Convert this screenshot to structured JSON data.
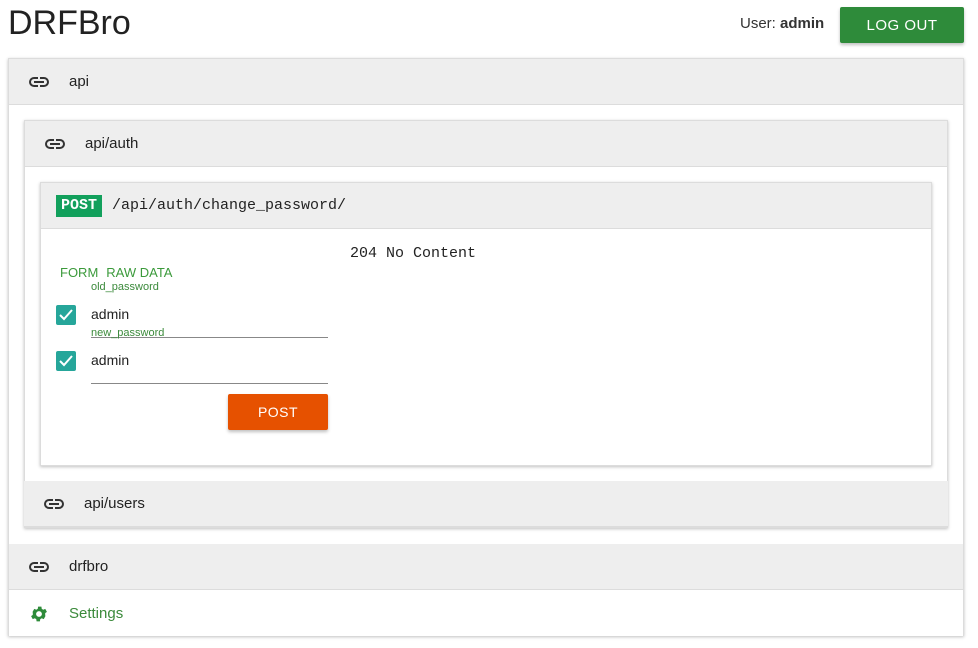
{
  "app": {
    "title": "DRFBro"
  },
  "user": {
    "label": "User:",
    "name": "admin"
  },
  "header": {
    "logout_label": "LOG OUT"
  },
  "sections": {
    "api": {
      "label": "api"
    },
    "api_auth": {
      "label": "api/auth"
    },
    "api_users": {
      "label": "api/users"
    },
    "drfbro": {
      "label": "drfbro"
    },
    "settings": {
      "label": "Settings"
    }
  },
  "endpoint": {
    "method": "POST",
    "path": "/api/auth/change_password/",
    "tabs": [
      "FORM",
      "RAW DATA"
    ],
    "fields": [
      {
        "label": "old_password",
        "value": "admin",
        "checked": true
      },
      {
        "label": "new_password",
        "value": "admin",
        "checked": true
      }
    ],
    "submit_label": "POST",
    "response": "204 No Content"
  },
  "colors": {
    "accent_green": "#2e8b3a",
    "post_badge": "#12a05c",
    "post_button": "#e65100",
    "checkbox": "#26a69a",
    "link_green": "#3b8a3b"
  }
}
